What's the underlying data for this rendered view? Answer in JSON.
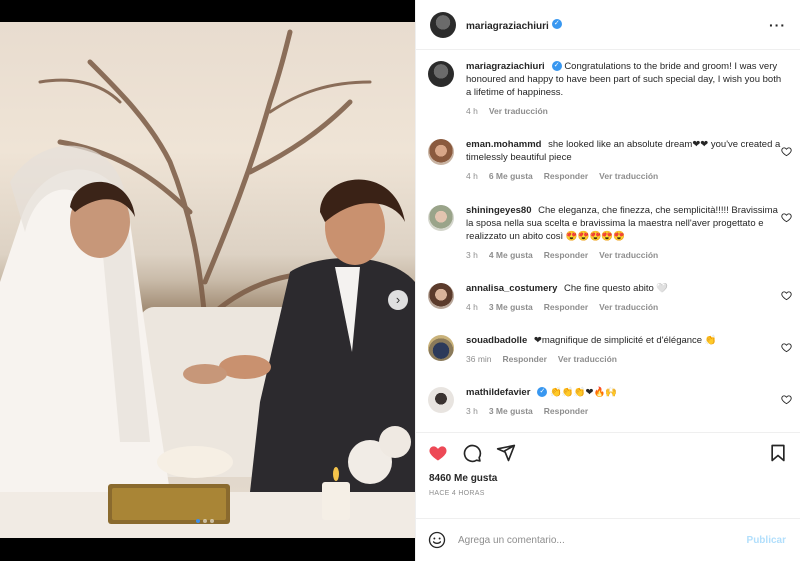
{
  "post": {
    "author": "mariagraziachiuri",
    "author_verified": true,
    "caption": "Congratulations to the bride and groom! I was very honoured and happy to have been part of such special day, I wish you both a lifetime of happiness.",
    "caption_time": "4 h",
    "caption_translate": "Ver traducción",
    "likes": "8460 Me gusta",
    "time_ago": "HACE 4 HORAS",
    "carousel": {
      "total": 3,
      "current": 1
    }
  },
  "comments": [
    {
      "username": "eman.mohammd",
      "text": "she looked like an absolute dream❤❤ you've created a timelessly beautiful piece",
      "time": "4 h",
      "likes": "6 Me gusta",
      "reply": "Responder",
      "translate": "Ver traducción"
    },
    {
      "username": "shiningeyes80",
      "text": "Che eleganza, che finezza, che semplicità!!!!! Bravissima la sposa nella sua scelta e bravissima la maestra nell'aver progettato e realizzato un abito così 😍😍😍😍😍",
      "time": "3 h",
      "likes": "4 Me gusta",
      "reply": "Responder",
      "translate": "Ver traducción"
    },
    {
      "username": "annalisa_costumery",
      "text": "Che fine questo abito 🤍",
      "time": "4 h",
      "likes": "3 Me gusta",
      "reply": "Responder",
      "translate": "Ver traducción"
    },
    {
      "username": "souadbadolle",
      "text": "❤magnifique de simplicité et d'élégance 👏",
      "time": "36 min",
      "likes": "",
      "reply": "Responder",
      "translate": "Ver traducción"
    },
    {
      "username": "mathildefavier",
      "verified": true,
      "text": "👏👏👏❤🔥🙌",
      "time": "3 h",
      "likes": "3 Me gusta",
      "reply": "Responder",
      "translate": ""
    }
  ],
  "comment_box": {
    "placeholder": "Agrega un comentario...",
    "publish_label": "Publicar"
  },
  "icons": {
    "more": "more-options-icon",
    "like": "heart-icon",
    "comment": "comment-icon",
    "share": "paper-plane-icon",
    "save": "bookmark-icon",
    "emoji": "smiley-icon",
    "next": "chevron-right-icon"
  },
  "colors": {
    "like_active": "#ed4956",
    "verified": "#3897f0",
    "publish_disabled": "#b2dffc",
    "carousel_active": "#3e8ee8"
  }
}
